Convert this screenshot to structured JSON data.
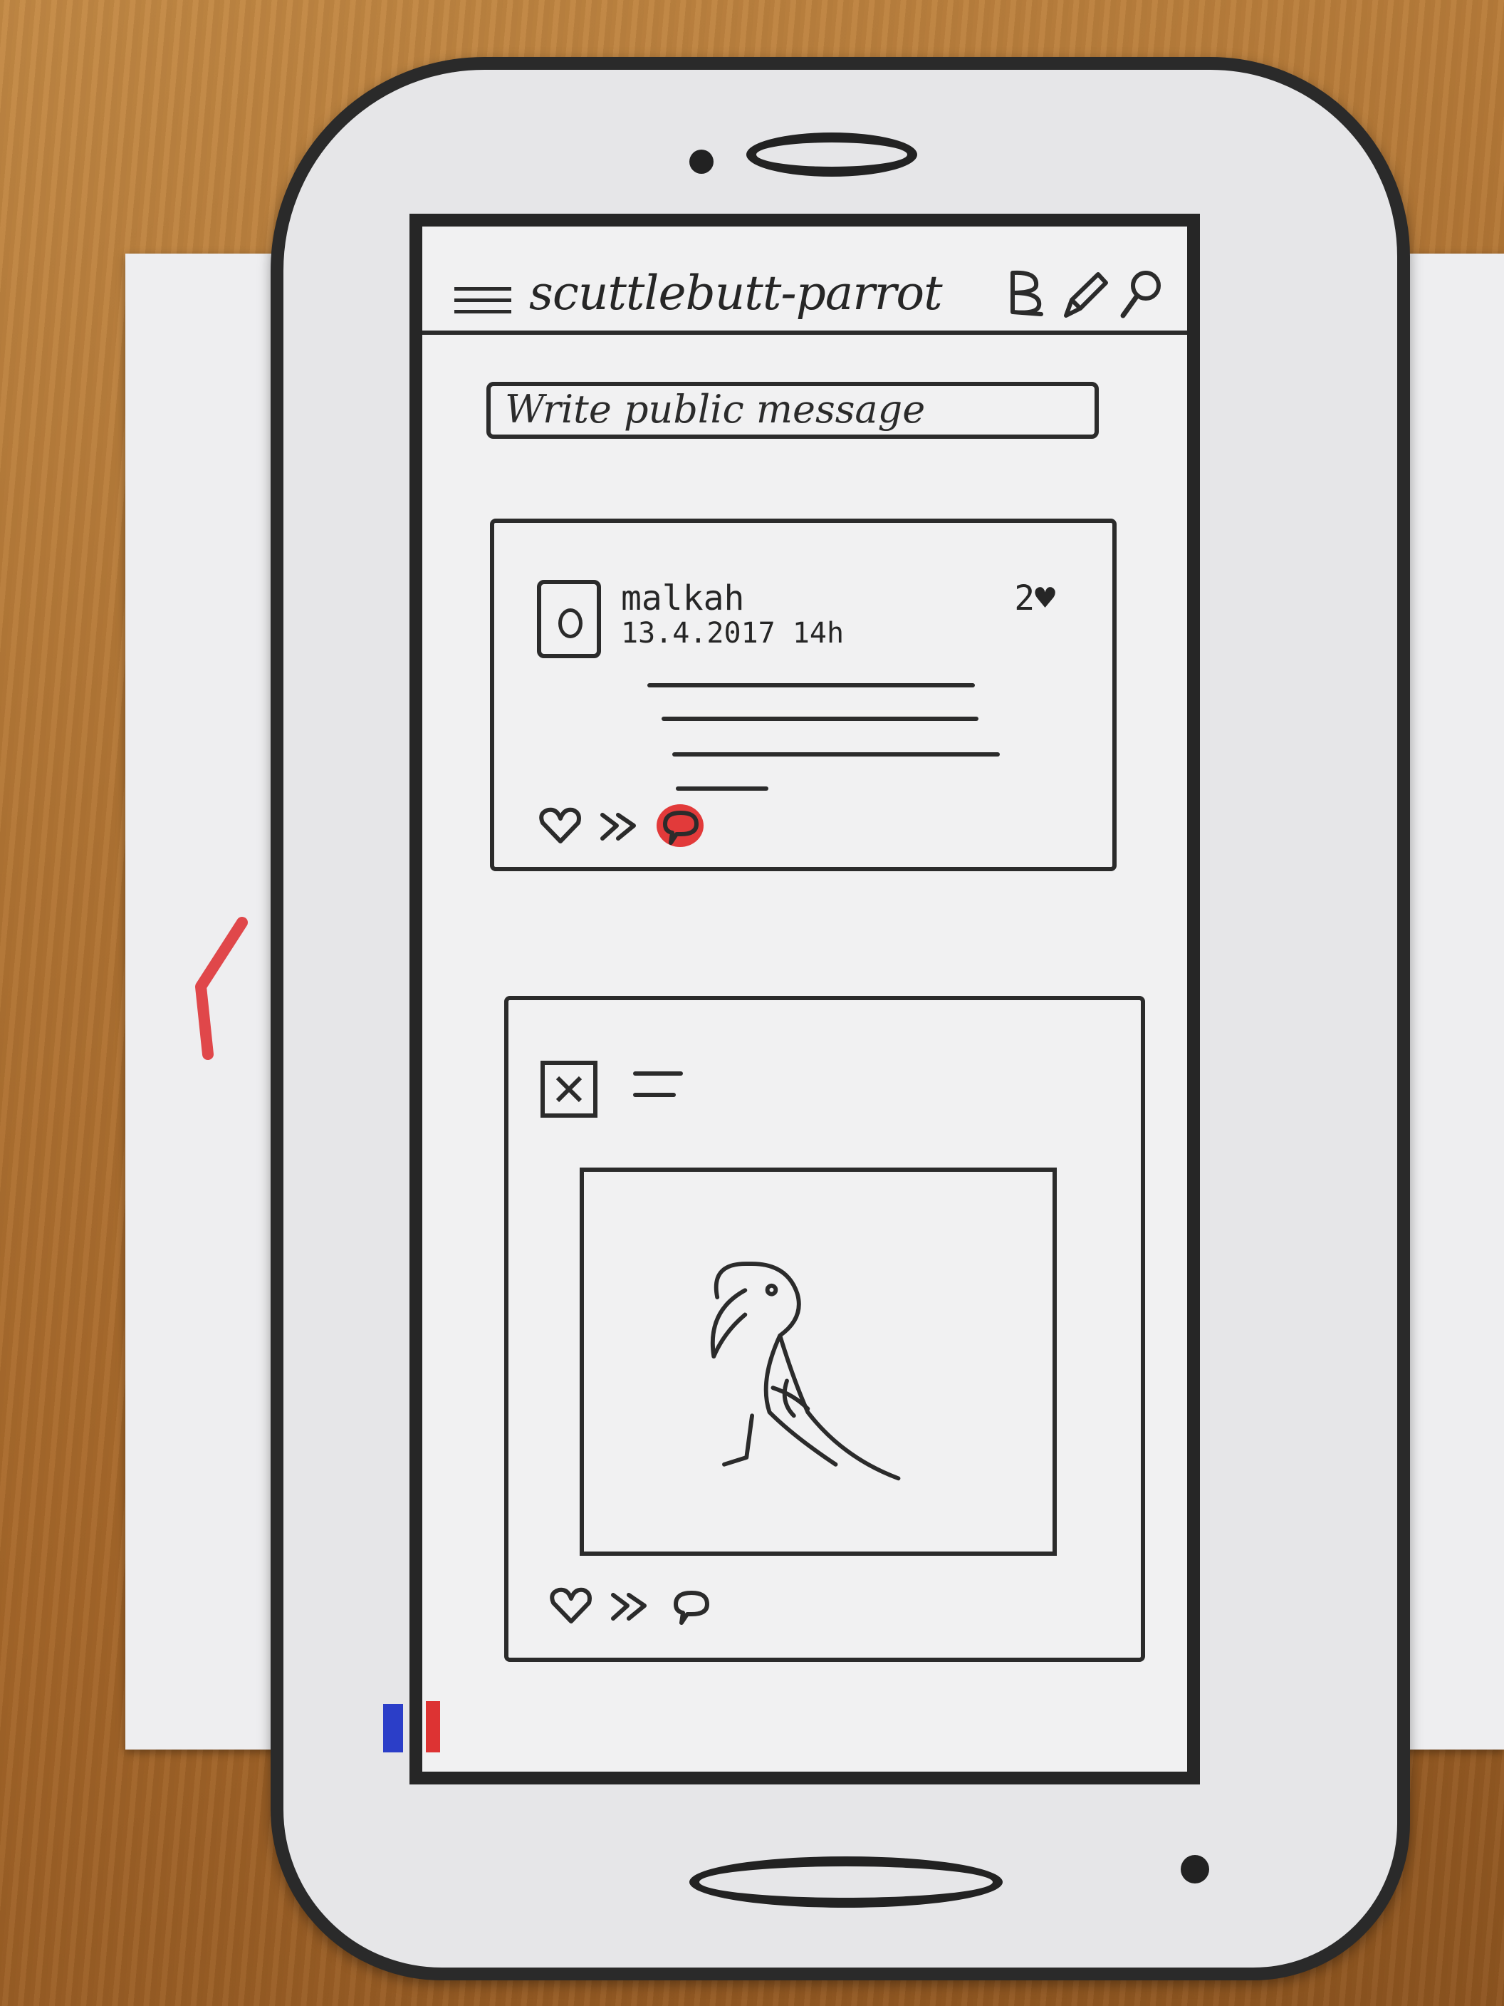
{
  "app": {
    "title": "scuttlebutt-parrot"
  },
  "toolbar": {
    "menu_icon": "hamburger-menu-icon",
    "icons": [
      "bold-b-icon",
      "pencil-icon",
      "search-icon"
    ]
  },
  "composer": {
    "placeholder": "Write public message"
  },
  "feed": {
    "posts": [
      {
        "author": "malkah",
        "timestamp": "13.4.2017 14h",
        "likes": "2♥",
        "actions": [
          "heart-icon",
          "forward-icon",
          "reply-icon"
        ]
      },
      {
        "author": "",
        "has_image": true,
        "actions": [
          "heart-icon",
          "forward-icon",
          "reply-icon"
        ]
      }
    ]
  },
  "colors": {
    "ink": "#2b2b2b",
    "highlight": "#e23a3a"
  }
}
